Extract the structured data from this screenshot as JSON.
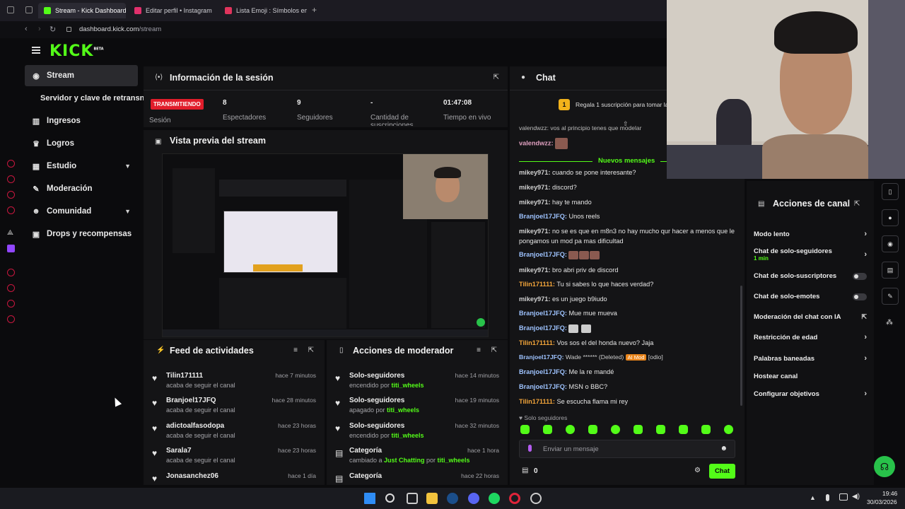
{
  "browser": {
    "tabs": [
      {
        "label": "Stream - Kick Dashboard",
        "color": "#53fc18"
      },
      {
        "label": "Editar perfil • Instagram",
        "color": "#e1306c"
      },
      {
        "label": "Lista Emoji : Símbolos em",
        "color": "#e0345c"
      }
    ],
    "url_domain": "dashboard.kick.com",
    "url_path": "/stream",
    "add_tab_icon": "+"
  },
  "header": {
    "logo": "KICK",
    "logo_beta": "BETA"
  },
  "sidebar": {
    "items": [
      {
        "label": "Stream",
        "icon": "radio-icon"
      },
      {
        "label": "Servidor y clave de retransn",
        "icon": ""
      },
      {
        "label": "Ingresos",
        "icon": "bar-chart-icon"
      },
      {
        "label": "Logros",
        "icon": "trophy-icon"
      },
      {
        "label": "Estudio",
        "icon": "layout-icon"
      },
      {
        "label": "Moderación",
        "icon": "wrench-icon"
      },
      {
        "label": "Comunidad",
        "icon": "users-icon"
      },
      {
        "label": "Drops y recompensas",
        "icon": "gift-icon"
      }
    ]
  },
  "session": {
    "title": "Información de la sesión",
    "live_badge": "TRANSMITIENDO",
    "session_label": "Sesión",
    "stats": [
      {
        "value": "8",
        "label": "Espectadores"
      },
      {
        "value": "9",
        "label": "Seguidores"
      },
      {
        "value": "-",
        "label": "Cantidad de suscripciones"
      },
      {
        "value": "01:47:08",
        "label": "Tiempo en vivo"
      }
    ]
  },
  "preview": {
    "title": "Vista previa del stream"
  },
  "feed": {
    "title": "Feed de actividades",
    "items": [
      {
        "name": "Tilin171111",
        "desc": "acaba de seguir el canal",
        "time": "hace 7 minutos"
      },
      {
        "name": "Branjoel17JFQ",
        "desc": "acaba de seguir el canal",
        "time": "hace 28 minutos"
      },
      {
        "name": "adictoalfasodopa",
        "desc": "acaba de seguir el canal",
        "time": "hace 23 horas"
      },
      {
        "name": "Sarala7",
        "desc": "acaba de seguir el canal",
        "time": "hace 23 horas"
      },
      {
        "name": "Jonasanchez06",
        "desc": "",
        "time": "hace 1 día"
      }
    ]
  },
  "modactions": {
    "title": "Acciones de moderador",
    "items": [
      {
        "name": "Solo-seguidores",
        "desc_a": "encendido por ",
        "desc_b": "",
        "user": "titi_wheels",
        "time": "hace 14 minutos"
      },
      {
        "name": "Solo-seguidores",
        "desc_a": "apagado por ",
        "desc_b": "",
        "user": "titi_wheels",
        "time": "hace 19 minutos"
      },
      {
        "name": "Solo-seguidores",
        "desc_a": "encendido por ",
        "desc_b": "",
        "user": "titi_wheels",
        "time": "hace 32 minutos"
      },
      {
        "name": "Categoría",
        "desc_a": "cambiado a ",
        "desc_b": "Just Chatting",
        "desc_c": " por ",
        "user": "titi_wheels",
        "time": "hace 1 hora"
      },
      {
        "name": "Categoría",
        "desc_a": "",
        "desc_b": "",
        "user": "",
        "time": "hace 22 horas"
      }
    ]
  },
  "chat": {
    "title": "Chat",
    "gift_number": "1",
    "gift_text": "Regala 1 suscripción para tomar la",
    "top_partial": "valendwzz: vos al principio tenes que modelar",
    "new_messages": "Nuevos mensajes",
    "messages": [
      {
        "user": "valendwzz:",
        "text": "",
        "cls": "u-p"
      },
      {
        "user": "mikey971:",
        "text": "cuando se pone interesante?",
        "cls": "u-g"
      },
      {
        "user": "mikey971:",
        "text": "discord?",
        "cls": "u-g"
      },
      {
        "user": "mikey971:",
        "text": "hay te mando",
        "cls": "u-g"
      },
      {
        "user": "BranjoeI17JFQ:",
        "text": "Unos reels",
        "cls": "u-b"
      },
      {
        "user": "mikey971:",
        "text": "no se es que en m8n3 no hay mucho qur hacer a menos que le pongamos un mod pa mas dificultad",
        "cls": "u-g"
      },
      {
        "user": "BranjoeI17JFQ:",
        "text": "",
        "cls": "u-b"
      },
      {
        "user": "mikey971:",
        "text": "bro abri priv de discord",
        "cls": "u-g"
      },
      {
        "user": "Tilin171111:",
        "text": "Tu si sabes lo que haces verdad?",
        "cls": "u-o"
      },
      {
        "user": "mikey971:",
        "text": "es un juego b9iudo",
        "cls": "u-g"
      },
      {
        "user": "BranjoeI17JFQ:",
        "text": "Mue mue mueva",
        "cls": "u-b"
      },
      {
        "user": "BranjoeI17JFQ:",
        "text": "",
        "cls": "u-b"
      },
      {
        "user": "Tilin171111:",
        "text": "Vos sos el del honda nuevo? Jaja",
        "cls": "u-o"
      },
      {
        "user": "BranjoeI17JFQ:",
        "text": "Wade ****** (Deleted)",
        "cls": "u-b"
      },
      {
        "user": "BranjoeI17JFQ:",
        "text": "Me la re mandé",
        "cls": "u-b"
      },
      {
        "user": "BranjoeI17JFQ:",
        "text": "MSN o BBC?",
        "cls": "u-b"
      },
      {
        "user": "Tilin171111:",
        "text": "Se escucha flama mi rey",
        "cls": "u-o"
      }
    ],
    "ai_mod": "AI Mod",
    "ai_mod_word": "[odio]",
    "followers_only": "Solo seguidores",
    "input_placeholder": "Enviar un mensaje",
    "points": "0",
    "send_label": "Chat"
  },
  "channel_actions": {
    "title": "Acciones de canal",
    "items": [
      {
        "label": "Modo lento",
        "control": "chevron"
      },
      {
        "label": "Chat de solo-seguidores",
        "sub": "1 min",
        "control": "chevron"
      },
      {
        "label": "Chat de solo-suscriptores",
        "control": "toggle"
      },
      {
        "label": "Chat de solo-emotes",
        "control": "toggle"
      },
      {
        "label": "Moderación del chat con IA",
        "control": "external"
      },
      {
        "label": "Restricción de edad",
        "control": "chevron"
      },
      {
        "label": "Palabras baneadas",
        "control": "chevron"
      },
      {
        "label": "Hostear canal",
        "control": "none"
      },
      {
        "label": "Configurar objetivos",
        "control": "chevron"
      }
    ]
  },
  "taskbar": {
    "time": "19:46",
    "date": "30/03/2026"
  },
  "colors": {
    "brand": "#53fc18",
    "live": "#e11d2b",
    "panel": "#141416",
    "bg": "#0b0b0d"
  }
}
